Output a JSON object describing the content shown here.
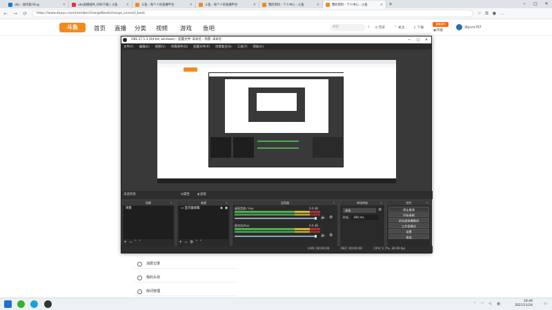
{
  "browser": {
    "tabs": [
      {
        "title": "obs - 国内版 Bing",
        "fav_color": "#0c7bd8"
      },
      {
        "title": "obs直播插件_OBS下载 | 斗鱼",
        "fav_color": "#e7343b"
      },
      {
        "title": "斗鱼 - 每个人的直播平台",
        "fav_color": "#f38a1f"
      },
      {
        "title": "斗鱼 - 每个人的直播平台",
        "fav_color": "#f38a1f"
      },
      {
        "title": "我的资料 - 个人中心 - 斗鱼",
        "fav_color": "#f38a1f"
      },
      {
        "title": "我的资料 - 个人中心 - 斗鱼",
        "fav_color": "#f38a1f"
      }
    ],
    "active_tab": 5,
    "close_glyph": "×",
    "new_tab_glyph": "+",
    "url": "https://www.douyu.com/member/changeBank/change_convert_bank"
  },
  "site": {
    "logo": "斗鱼",
    "nav": [
      "首页",
      "直播",
      "分类",
      "视频",
      "游戏",
      "鱼吧"
    ],
    "search_placeholder": "搜索",
    "icons": [
      {
        "label": "历史",
        "name": "history-icon"
      },
      {
        "label": "关注",
        "name": "heart-icon"
      },
      {
        "label": "下载",
        "name": "download-icon"
      },
      {
        "label": "开播",
        "name": "broadcast-icon"
      }
    ],
    "badge": "直播福利",
    "user": "清pure787",
    "accent": "#f38a1f"
  },
  "obs": {
    "title": "OBS 27.1.3 (64-bit, windows) - 配置文件: 未命名 - 场景: 未命名",
    "menu": [
      "文件(F)",
      "编辑(E)",
      "视图(V)",
      "停靠部件(D)",
      "配置文件(P)",
      "场景集合(S)",
      "工具(T)",
      "帮助(H)"
    ],
    "source_bar": {
      "label": "未选择源",
      "properties": "属性",
      "filters": "滤镜"
    },
    "docks": {
      "scenes": {
        "title": "场景",
        "items": [
          "场景"
        ]
      },
      "sources": {
        "title": "来源",
        "items": [
          "显示器采集"
        ]
      },
      "mixer": {
        "title": "混音器",
        "channels": [
          {
            "label": "桌面音频 / Aux",
            "value": "0.0 dB"
          },
          {
            "label": "麦克风/Aux",
            "value": "0.0 dB"
          }
        ]
      },
      "transitions": {
        "title": "转场特效",
        "type": "淡化",
        "duration_label": "时长",
        "duration": "300 ms"
      },
      "controls": {
        "title": "控件",
        "buttons": [
          "停止推流",
          "开始录制",
          "启动虚拟摄像机",
          "工作室模式",
          "设置",
          "退出"
        ]
      }
    },
    "status": {
      "live": "LIVE: 00:00:00",
      "rec": "REC: 00:00:00",
      "cpu": "CPU: 1.7%, 30.00 fps"
    }
  },
  "page_menu": [
    "消费记录",
    "我的头衔",
    "房间管理"
  ],
  "taskbar": {
    "time": "16:46",
    "date": "2021/11/24",
    "ime": "英"
  }
}
